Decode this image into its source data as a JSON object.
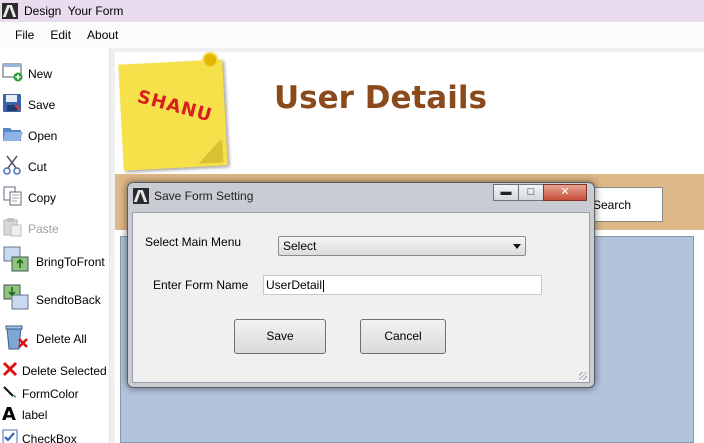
{
  "window": {
    "title": "Design  Your Form"
  },
  "menu": {
    "items": [
      "File",
      "Edit",
      "About"
    ]
  },
  "toolbox": {
    "items": [
      {
        "label": "New",
        "icon": "new-form-icon",
        "enabled": true
      },
      {
        "label": "Save",
        "icon": "save-icon",
        "enabled": true
      },
      {
        "label": "Open",
        "icon": "open-folder-icon",
        "enabled": true
      },
      {
        "label": "Cut",
        "icon": "scissors-icon",
        "enabled": true
      },
      {
        "label": "Copy",
        "icon": "copy-icon",
        "enabled": true
      },
      {
        "label": "Paste",
        "icon": "paste-icon",
        "enabled": false
      },
      {
        "label": "BringToFront",
        "icon": "bring-to-front-icon",
        "enabled": true
      },
      {
        "label": "SendtoBack",
        "icon": "send-to-back-icon",
        "enabled": true
      },
      {
        "label": "Delete All",
        "icon": "recycle-bin-icon",
        "enabled": true
      },
      {
        "label": "Delete Selected",
        "icon": "red-x-icon",
        "enabled": true
      },
      {
        "label": "FormColor",
        "icon": "color-pen-icon",
        "enabled": true
      },
      {
        "label": "label",
        "icon": "label-a-icon",
        "enabled": true
      },
      {
        "label": "CheckBox",
        "icon": "checkbox-icon",
        "enabled": true
      }
    ]
  },
  "design_surface": {
    "logo_text": "SHANU",
    "heading": "User Details",
    "search_button_label": "Search",
    "colors": {
      "heading": "#8b4a1c",
      "band": "#ddb888",
      "panel": "#b2c4dc",
      "sticky_note": "#f7e14a"
    }
  },
  "dialog": {
    "title": "Save Form Setting",
    "main_menu_label": "Select Main Menu",
    "main_menu_selected": "Select",
    "form_name_label": "Enter Form Name",
    "form_name_value": "UserDetail",
    "save_label": "Save",
    "cancel_label": "Cancel",
    "title_buttons": {
      "minimize": "minimize-icon",
      "maximize": "maximize-icon",
      "close": "close-icon"
    }
  }
}
